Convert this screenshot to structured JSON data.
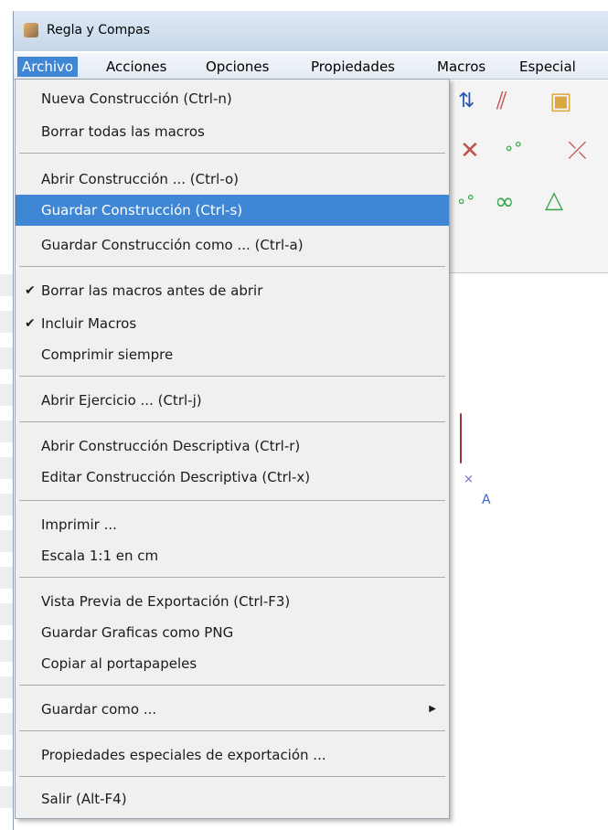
{
  "window": {
    "title": "Regla y Compas"
  },
  "menubar": {
    "items": [
      "Archivo",
      "Acciones",
      "Opciones",
      "Propiedades",
      "Macros",
      "Especial"
    ],
    "active": "Archivo"
  },
  "canvas": {
    "point_label": "A"
  },
  "colors": {
    "highlight": "#3f86d4",
    "menu_bg": "#f0f0f0",
    "point_label": "#3a5fd0"
  },
  "menu": {
    "items": [
      {
        "label": "Nueva Construcción (Ctrl-n)"
      },
      {
        "label": "Borrar todas las macros"
      },
      {
        "label": "Abrir Construcción ... (Ctrl-o)"
      },
      {
        "label": "Guardar Construcción (Ctrl-s)",
        "highlighted": true
      },
      {
        "label": "Guardar Construcción como ... (Ctrl-a)"
      },
      {
        "label": "Borrar las macros antes de abrir",
        "checked": true
      },
      {
        "label": "Incluir Macros",
        "checked": true
      },
      {
        "label": "Comprimir siempre"
      },
      {
        "label": "Abrir Ejercicio ... (Ctrl-j)"
      },
      {
        "label": "Abrir Construcción Descriptiva (Ctrl-r)"
      },
      {
        "label": "Editar Construcción Descriptiva (Ctrl-x)"
      },
      {
        "label": "Imprimir ..."
      },
      {
        "label": "Escala 1:1 en cm"
      },
      {
        "label": "Vista Previa de Exportación (Ctrl-F3)"
      },
      {
        "label": "Guardar Graficas como PNG"
      },
      {
        "label": "Copiar al portapapeles"
      },
      {
        "label": "Guardar como ...",
        "submenu": true
      },
      {
        "label": "Propiedades especiales de exportación ..."
      },
      {
        "label": "Salir (Alt-F4)"
      }
    ]
  }
}
